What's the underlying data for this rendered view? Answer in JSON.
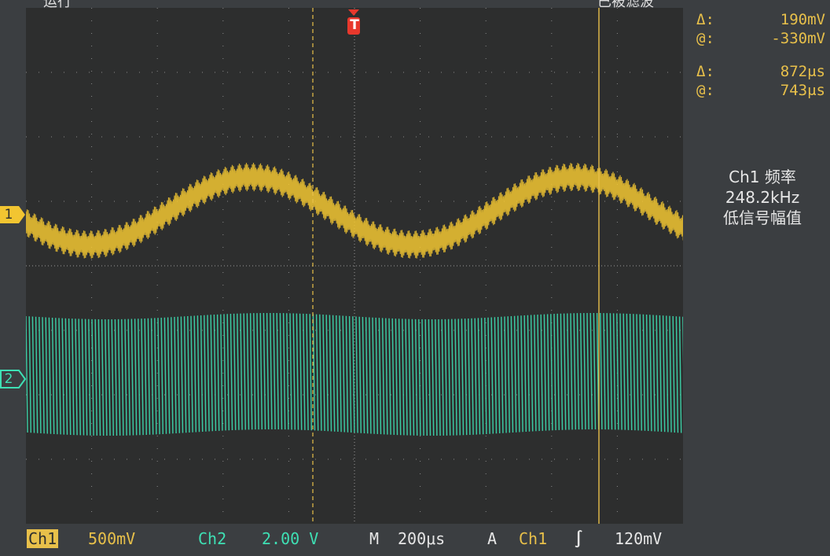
{
  "top_bar": {
    "left_label": "运行",
    "right_label": "已被滤波"
  },
  "cursor_readouts": {
    "voltage_delta_label": "Δ:",
    "voltage_delta_value": "190mV",
    "voltage_at_label": "@:",
    "voltage_at_value": "-330mV",
    "time_delta_label": "Δ:",
    "time_delta_value": "872μs",
    "time_at_label": "@:",
    "time_at_value": "743μs"
  },
  "measurement": {
    "line1": "Ch1 频率",
    "line2": "248.2kHz",
    "line3": "低信号幅值"
  },
  "markers": {
    "ch1": "1",
    "ch2": "2",
    "trigger": "T"
  },
  "bottom_bar": {
    "ch1_label": "Ch1",
    "ch1_scale": "500mV",
    "ch2_label": "Ch2",
    "ch2_scale": "2.00 V",
    "timebase_label": "M",
    "timebase_value": "200μs",
    "trigger_mode": "A",
    "trigger_source": "Ch1",
    "trigger_slope": "∫",
    "trigger_level": "120mV"
  },
  "colors": {
    "ch1": "#f2c531",
    "ch2": "#3ee0b4",
    "grid": "#8a8a8a",
    "readout": "#e8c04a",
    "trigger": "#e8382c"
  }
}
